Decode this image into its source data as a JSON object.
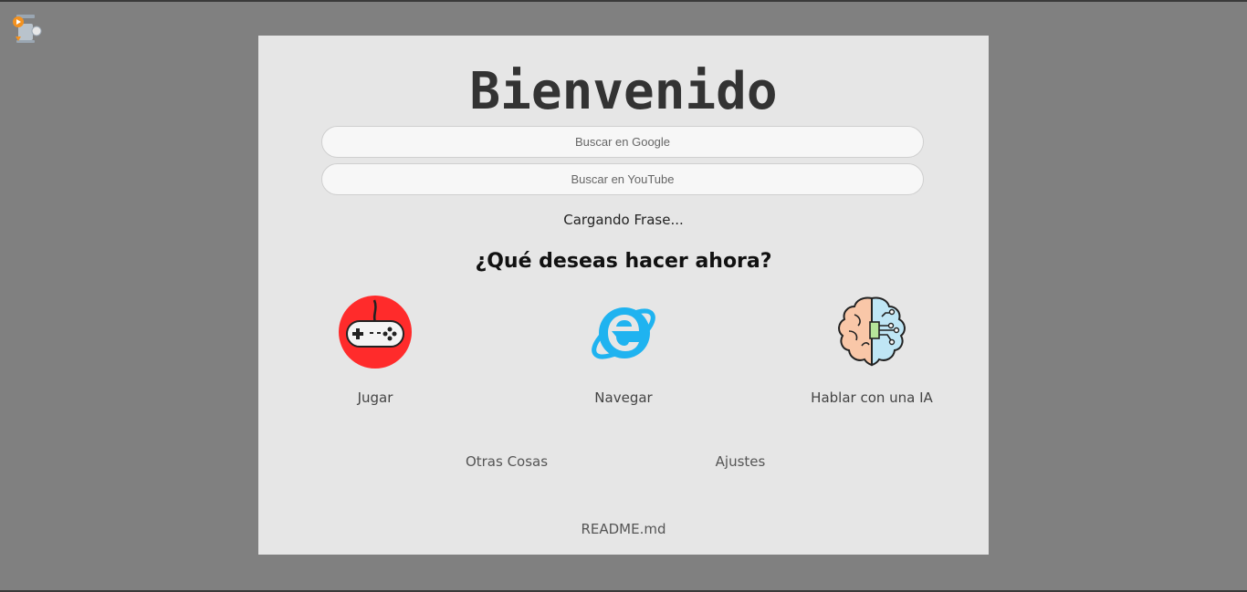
{
  "header": {
    "title": "Bienvenido"
  },
  "search": {
    "google_placeholder": "Buscar en Google",
    "youtube_placeholder": "Buscar en YouTube"
  },
  "quote": {
    "text": "Cargando Frase..."
  },
  "question": {
    "text": "¿Qué deseas hacer ahora?"
  },
  "actions": [
    {
      "label": "Jugar",
      "icon": "gamepad-icon"
    },
    {
      "label": "Navegar",
      "icon": "browser-icon"
    },
    {
      "label": "Hablar con una IA",
      "icon": "brain-icon"
    }
  ],
  "links": {
    "other": "Otras Cosas",
    "settings": "Ajustes",
    "readme": "README.md"
  },
  "colors": {
    "background": "#808080",
    "panel": "#e6e6e6",
    "gamepad_red": "#ff2b2b",
    "browser_blue": "#1fb3f0"
  }
}
